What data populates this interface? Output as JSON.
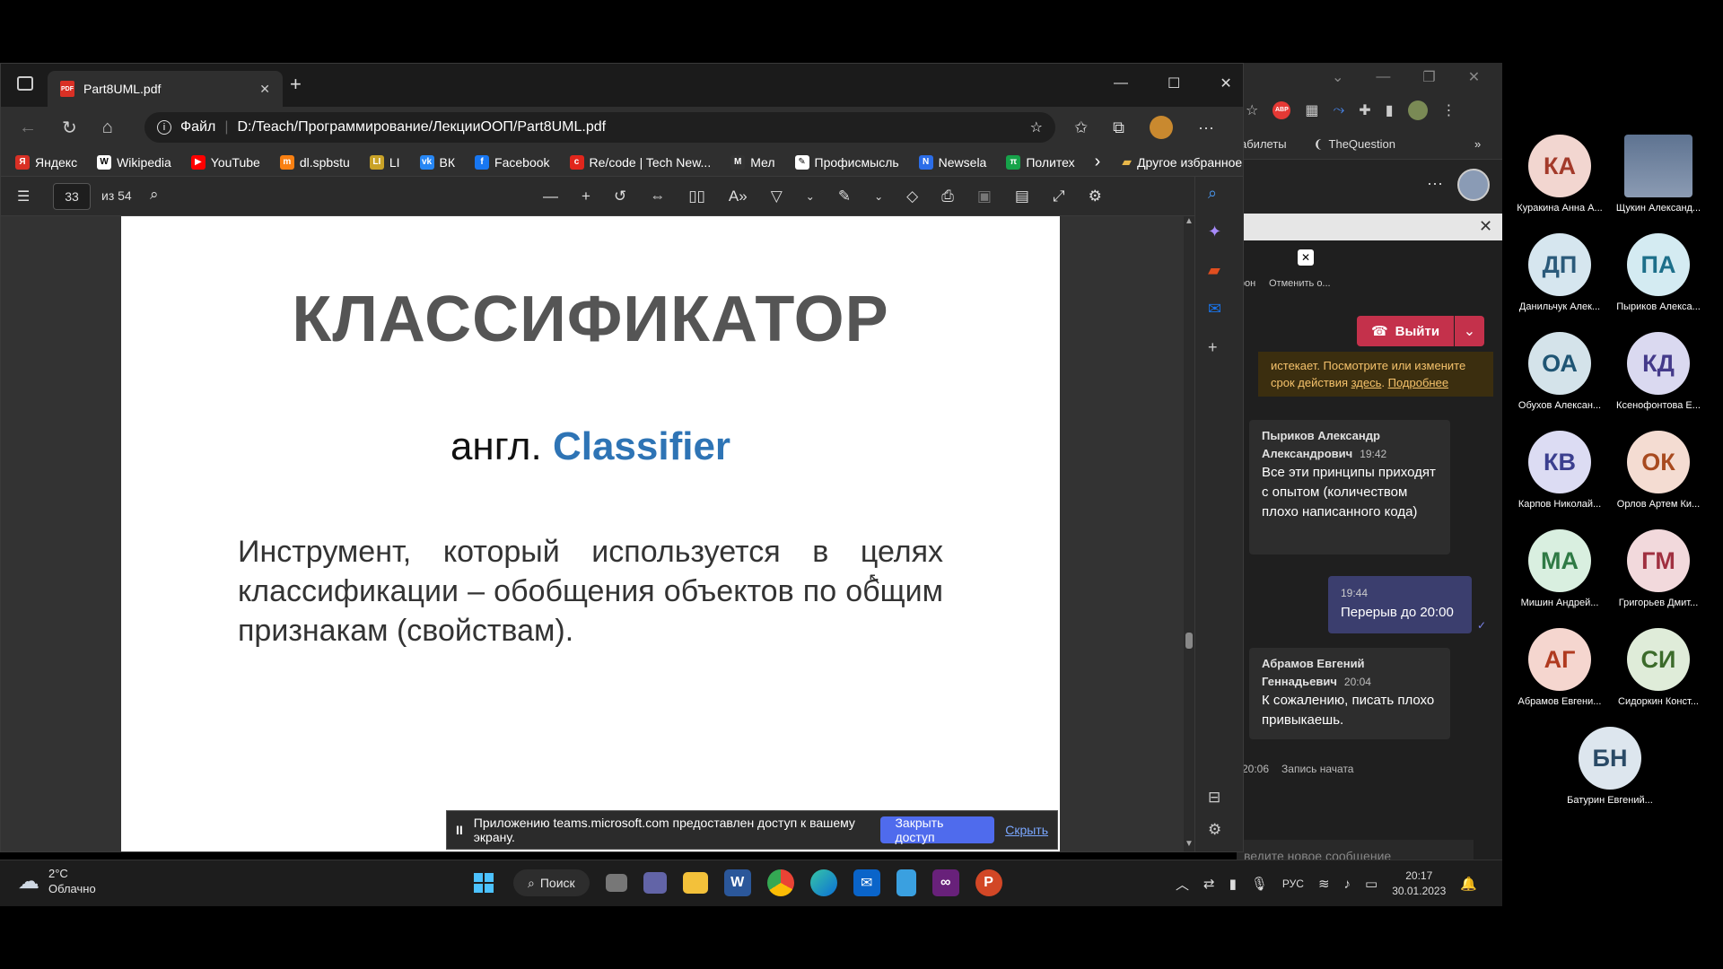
{
  "edge": {
    "tab_title": "Part8UML.pdf",
    "address_label": "Файл",
    "address_url": "D:/Teach/Программирование/ЛекцииООП/Part8UML.pdf",
    "bookmarks": [
      {
        "label": "Яндекс",
        "icon": "yandex-icon",
        "color": "#d93025",
        "glyph": "Я"
      },
      {
        "label": "Wikipedia",
        "icon": "wikipedia-icon",
        "color": "#ffffff",
        "glyph": "W"
      },
      {
        "label": "YouTube",
        "icon": "youtube-icon",
        "color": "#ff0000",
        "glyph": "▶"
      },
      {
        "label": "dl.spbstu",
        "icon": "moodle-icon",
        "color": "#f98012",
        "glyph": "m"
      },
      {
        "label": "LI",
        "icon": "li-icon",
        "color": "#c9a227",
        "glyph": "LI"
      },
      {
        "label": "ВК",
        "icon": "vk-icon",
        "color": "#2787f5",
        "glyph": "vk"
      },
      {
        "label": "Facebook",
        "icon": "facebook-icon",
        "color": "#1877f2",
        "glyph": "f"
      },
      {
        "label": "Re/code | Tech New...",
        "icon": "recode-icon",
        "color": "#e1261c",
        "glyph": "c"
      },
      {
        "label": "Мел",
        "icon": "mel-icon",
        "color": "#333333",
        "glyph": "M"
      },
      {
        "label": "Профисмысль",
        "icon": "profi-icon",
        "color": "#ffffff",
        "glyph": "✎"
      },
      {
        "label": "Newsela",
        "icon": "newsela-icon",
        "color": "#2b6de8",
        "glyph": "N"
      },
      {
        "label": "Политех",
        "icon": "polytech-icon",
        "color": "#16a34a",
        "glyph": "π"
      }
    ],
    "other_favorites": "Другое избранное",
    "pdf": {
      "current_page": "33",
      "total_pages": "из 54"
    },
    "slide": {
      "title": "КЛАССИФИКАТОР",
      "subtitle_prefix": "англ. ",
      "subtitle_term": "Classifier",
      "body": "Инструмент, который используется в целях классификации – обобщения объектов по общим признакам (свойствам)."
    },
    "share_bar": {
      "text": "Приложению teams.microsoft.com предоставлен доступ к вашему экрану.",
      "stop_button": "Закрыть доступ",
      "hide_link": "Скрыть"
    }
  },
  "teams": {
    "bookmarks": [
      "абилеты",
      "TheQuestion"
    ],
    "call": {
      "cancel_label": "Отменить о...",
      "phone_label": "фон",
      "leave_button": "Выйти"
    },
    "warning": {
      "text": "истекает. Посмотрите или измените срок действия",
      "link_here": "здесь",
      "link_more": "Подробнее"
    },
    "messages": [
      {
        "author_line1": "Пыриков Александр",
        "author_line2": "Александрович",
        "time": "19:42",
        "text": "Все эти принципы приходят с опытом (количеством плохо написанного кода)"
      },
      {
        "mine": true,
        "time": "19:44",
        "text": "Перерыв до 20:00"
      },
      {
        "author_line1": "Абрамов Евгений",
        "author_line2": "Геннадьевич",
        "time": "20:04",
        "text": "К сожалению, писать плохо привыкаешь."
      }
    ],
    "system_event": {
      "time": "20:06",
      "text": "Запись начата"
    },
    "compose_placeholder": "ведите новое сообщение"
  },
  "participants": [
    {
      "initials": "КА",
      "name": "Куракина Анна А...",
      "bg": "#f2d6d0",
      "fg": "#a33a2a"
    },
    {
      "initials": "",
      "name": "Щукин Александ...",
      "bg": "#6b7f9c",
      "fg": "#fff",
      "photo": true
    },
    {
      "initials": "ДП",
      "name": "Данильчук Алек...",
      "bg": "#d6e6ef",
      "fg": "#2b5a7a"
    },
    {
      "initials": "ПА",
      "name": "Пыриков Алекса...",
      "bg": "#d4ebf2",
      "fg": "#1d6f8a"
    },
    {
      "initials": "ОА",
      "name": "Обухов Алексан...",
      "bg": "#d4e3ea",
      "fg": "#1f5574"
    },
    {
      "initials": "КД",
      "name": "Ксенофонтова Е...",
      "bg": "#dad9f0",
      "fg": "#443a8a"
    },
    {
      "initials": "КВ",
      "name": "Карпов Николай...",
      "bg": "#dcdcf3",
      "fg": "#3b3f8f"
    },
    {
      "initials": "ОК",
      "name": "Орлов Артем Ки...",
      "bg": "#f4dcd2",
      "fg": "#a84a1f"
    },
    {
      "initials": "МА",
      "name": "Мишин Андрей...",
      "bg": "#d9efe0",
      "fg": "#2f7a45"
    },
    {
      "initials": "ГМ",
      "name": "Григорьев Дмит...",
      "bg": "#f2d9dc",
      "fg": "#a03040"
    },
    {
      "initials": "АГ",
      "name": "Абрамов Евгени...",
      "bg": "#f5d6cf",
      "fg": "#b03a1f"
    },
    {
      "initials": "СИ",
      "name": "Сидоркин Конст...",
      "bg": "#dfecd9",
      "fg": "#3c6b2b"
    },
    {
      "initials": "БН",
      "name": "Батурин Евгений...",
      "bg": "#dde6ee",
      "fg": "#2a4a66"
    }
  ],
  "taskbar": {
    "weather_temp": "2°C",
    "weather_desc": "Облачно",
    "search_label": "Поиск",
    "lang": "РУС",
    "time": "20:17",
    "date": "30.01.2023"
  },
  "colors": {
    "accent": "#4f6bed",
    "leave": "#c4314b",
    "classifier_blue": "#2e74b5"
  }
}
